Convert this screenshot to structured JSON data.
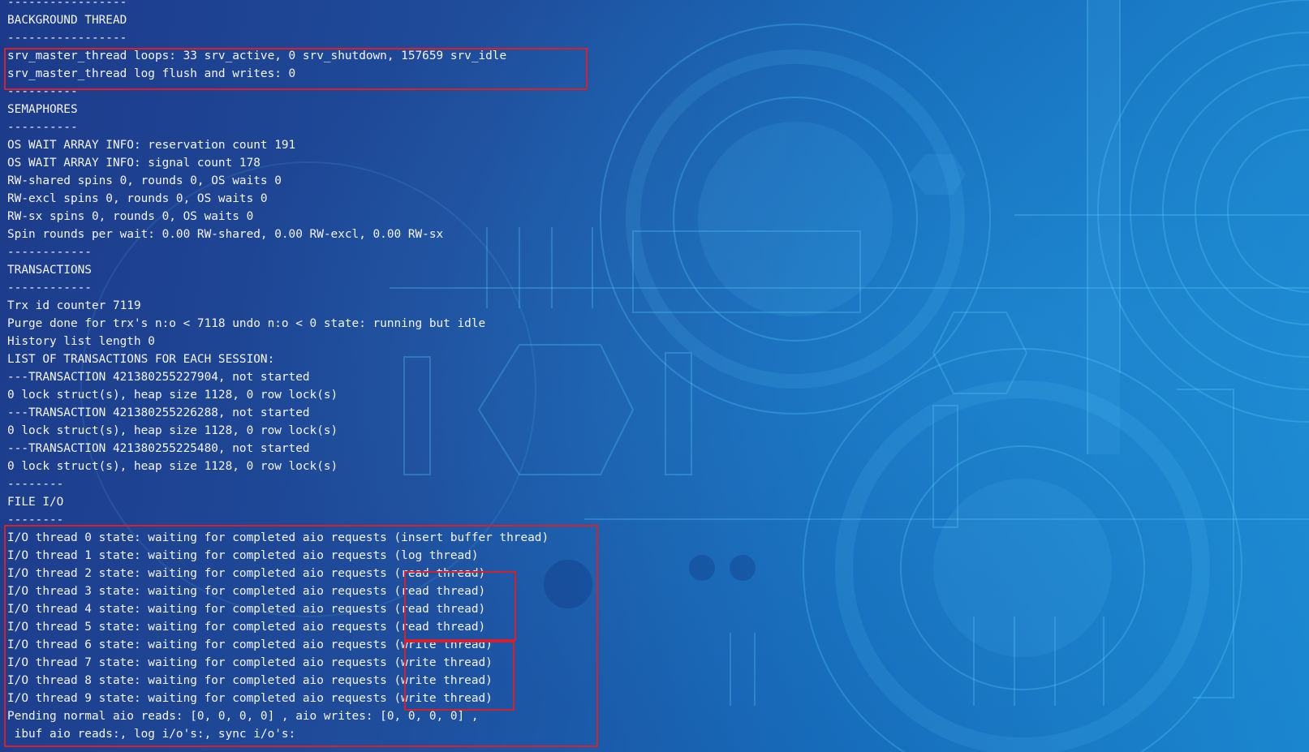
{
  "colors": {
    "background_start": "#1d3a8a",
    "background_end": "#1a86cf",
    "text": "#f2f6ff",
    "highlight_border": "#d8202c",
    "circuit_lines": "#5fd0ff"
  },
  "terminal": {
    "lines": [
      "-----------------",
      "BACKGROUND THREAD",
      "-----------------",
      "srv_master_thread loops: 33 srv_active, 0 srv_shutdown, 157659 srv_idle",
      "srv_master_thread log flush and writes: 0",
      "----------",
      "SEMAPHORES",
      "----------",
      "OS WAIT ARRAY INFO: reservation count 191",
      "OS WAIT ARRAY INFO: signal count 178",
      "RW-shared spins 0, rounds 0, OS waits 0",
      "RW-excl spins 0, rounds 0, OS waits 0",
      "RW-sx spins 0, rounds 0, OS waits 0",
      "Spin rounds per wait: 0.00 RW-shared, 0.00 RW-excl, 0.00 RW-sx",
      "------------",
      "TRANSACTIONS",
      "------------",
      "Trx id counter 7119",
      "Purge done for trx's n:o < 7118 undo n:o < 0 state: running but idle",
      "History list length 0",
      "LIST OF TRANSACTIONS FOR EACH SESSION:",
      "---TRANSACTION 421380255227904, not started",
      "0 lock struct(s), heap size 1128, 0 row lock(s)",
      "---TRANSACTION 421380255226288, not started",
      "0 lock struct(s), heap size 1128, 0 row lock(s)",
      "---TRANSACTION 421380255225480, not started",
      "0 lock struct(s), heap size 1128, 0 row lock(s)",
      "--------",
      "FILE I/O",
      "--------",
      "I/O thread 0 state: waiting for completed aio requests (insert buffer thread)",
      "I/O thread 1 state: waiting for completed aio requests (log thread)",
      "I/O thread 2 state: waiting for completed aio requests (read thread)",
      "I/O thread 3 state: waiting for completed aio requests (read thread)",
      "I/O thread 4 state: waiting for completed aio requests (read thread)",
      "I/O thread 5 state: waiting for completed aio requests (read thread)",
      "I/O thread 6 state: waiting for completed aio requests (write thread)",
      "I/O thread 7 state: waiting for completed aio requests (write thread)",
      "I/O thread 8 state: waiting for completed aio requests (write thread)",
      "I/O thread 9 state: waiting for completed aio requests (write thread)",
      "Pending normal aio reads: [0, 0, 0, 0] , aio writes: [0, 0, 0, 0] ,",
      " ibuf aio reads:, log i/o's:, sync i/o's:"
    ]
  }
}
